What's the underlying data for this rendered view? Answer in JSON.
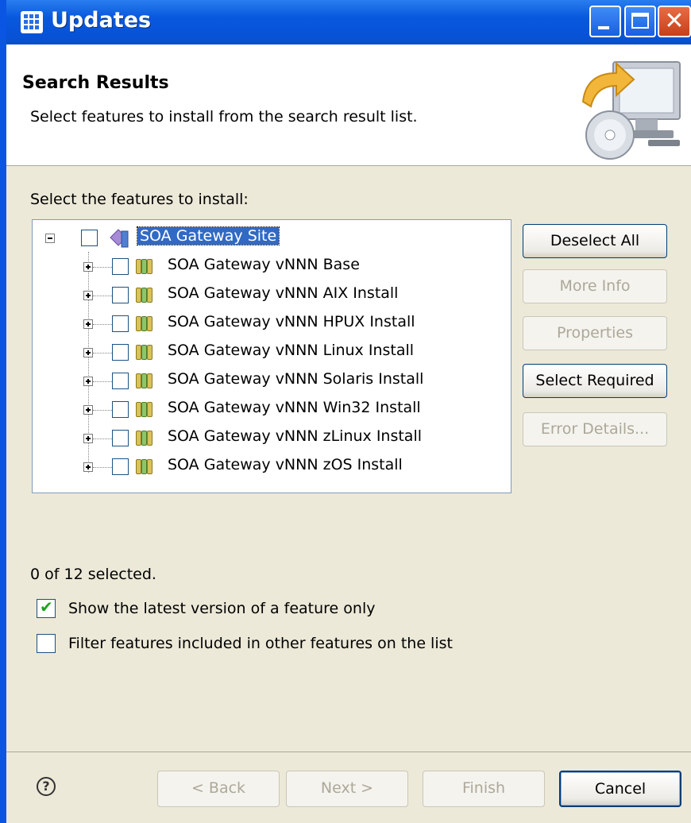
{
  "window": {
    "title": "Updates"
  },
  "banner": {
    "title": "Search Results",
    "description": "Select features to install from the search result list."
  },
  "features": {
    "label": "Select the features to install:",
    "root": {
      "label": "SOA Gateway Site",
      "checked": false,
      "expanded": true
    },
    "items": [
      {
        "label": "SOA Gateway vNNN Base",
        "checked": false
      },
      {
        "label": "SOA Gateway vNNN AIX Install",
        "checked": false
      },
      {
        "label": "SOA Gateway vNNN HPUX Install",
        "checked": false
      },
      {
        "label": "SOA Gateway vNNN Linux Install",
        "checked": false
      },
      {
        "label": "SOA Gateway vNNN Solaris Install",
        "checked": false
      },
      {
        "label": "SOA Gateway vNNN Win32 Install",
        "checked": false
      },
      {
        "label": "SOA Gateway vNNN zLinux Install",
        "checked": false
      },
      {
        "label": "SOA Gateway vNNN zOS Install",
        "checked": false
      }
    ]
  },
  "side_buttons": {
    "deselect_all": "Deselect All",
    "more_info": "More Info",
    "properties": "Properties",
    "select_required": "Select Required",
    "error_details": "Error Details..."
  },
  "status": "0 of 12 selected.",
  "options": {
    "latest_version": {
      "label": "Show the latest version of a feature only",
      "checked": true
    },
    "filter_included": {
      "label": "Filter features included in other features on the list",
      "checked": false
    }
  },
  "footer": {
    "help": "?",
    "back": "< Back",
    "next": "Next >",
    "finish": "Finish",
    "cancel": "Cancel"
  },
  "colors": {
    "titlebar": "#0858de",
    "selection": "#316ac5",
    "check": "#21a121"
  }
}
